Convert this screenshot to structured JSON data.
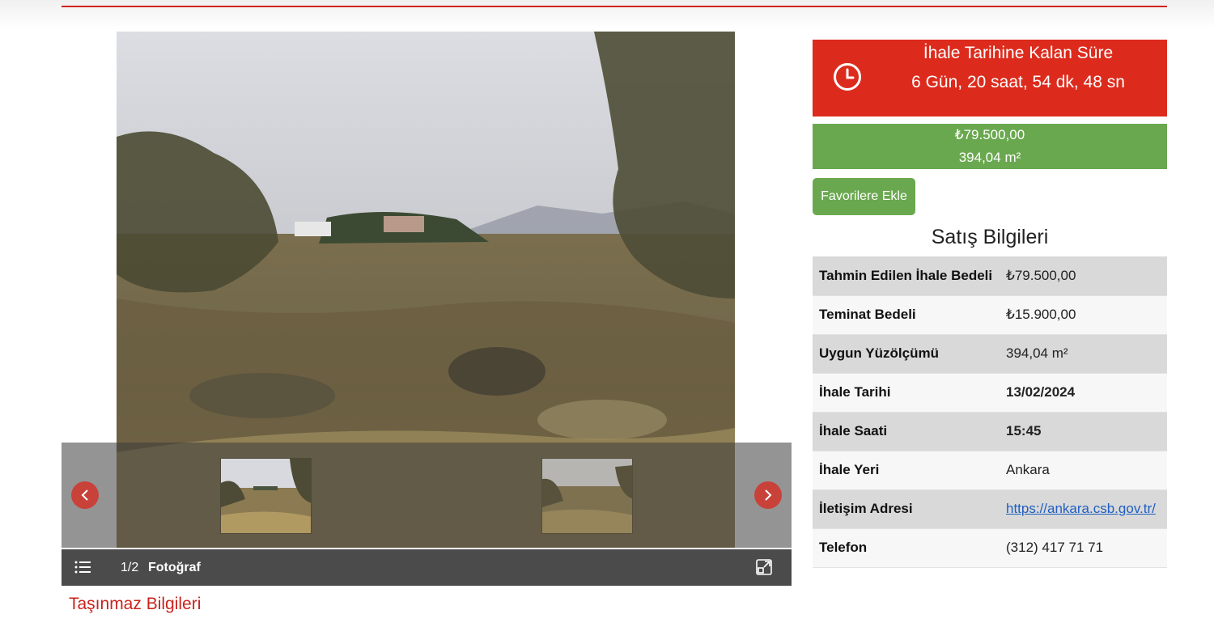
{
  "gallery": {
    "counter": "1/2",
    "label": "Fotoğraf"
  },
  "section_title": "Taşınmaz Bilgileri",
  "countdown": {
    "title": "İhale Tarihine Kalan Süre",
    "remaining": "6 Gün, 20 saat, 54 dk, 48 sn"
  },
  "price": {
    "amount": "₺79.500,00",
    "area": "394,04 m²"
  },
  "favorite_button": "Favorilere Ekle",
  "sales_title": "Satış Bilgileri",
  "sales_info": [
    {
      "key": "Tahmin Edilen İhale Bedeli",
      "value": "₺79.500,00"
    },
    {
      "key": "Teminat Bedeli",
      "value": "₺15.900,00"
    },
    {
      "key": "Uygun Yüzölçümü",
      "value": "394,04 m²"
    },
    {
      "key": "İhale Tarihi",
      "value": "13/02/2024"
    },
    {
      "key": "İhale Saati",
      "value": "15:45"
    },
    {
      "key": "İhale Yeri",
      "value": "Ankara"
    },
    {
      "key": "İletişim Adresi",
      "value": "https://ankara.csb.gov.tr/"
    },
    {
      "key": "Telefon",
      "value": "(312) 417 71 71"
    }
  ],
  "colors": {
    "accent_red": "#dc2b1c",
    "accent_green": "#6aa84f",
    "link_blue": "#1f5fc2"
  },
  "icons": [
    "clock-icon",
    "chevron-left-icon",
    "chevron-right-icon",
    "list-icon",
    "expand-icon"
  ]
}
